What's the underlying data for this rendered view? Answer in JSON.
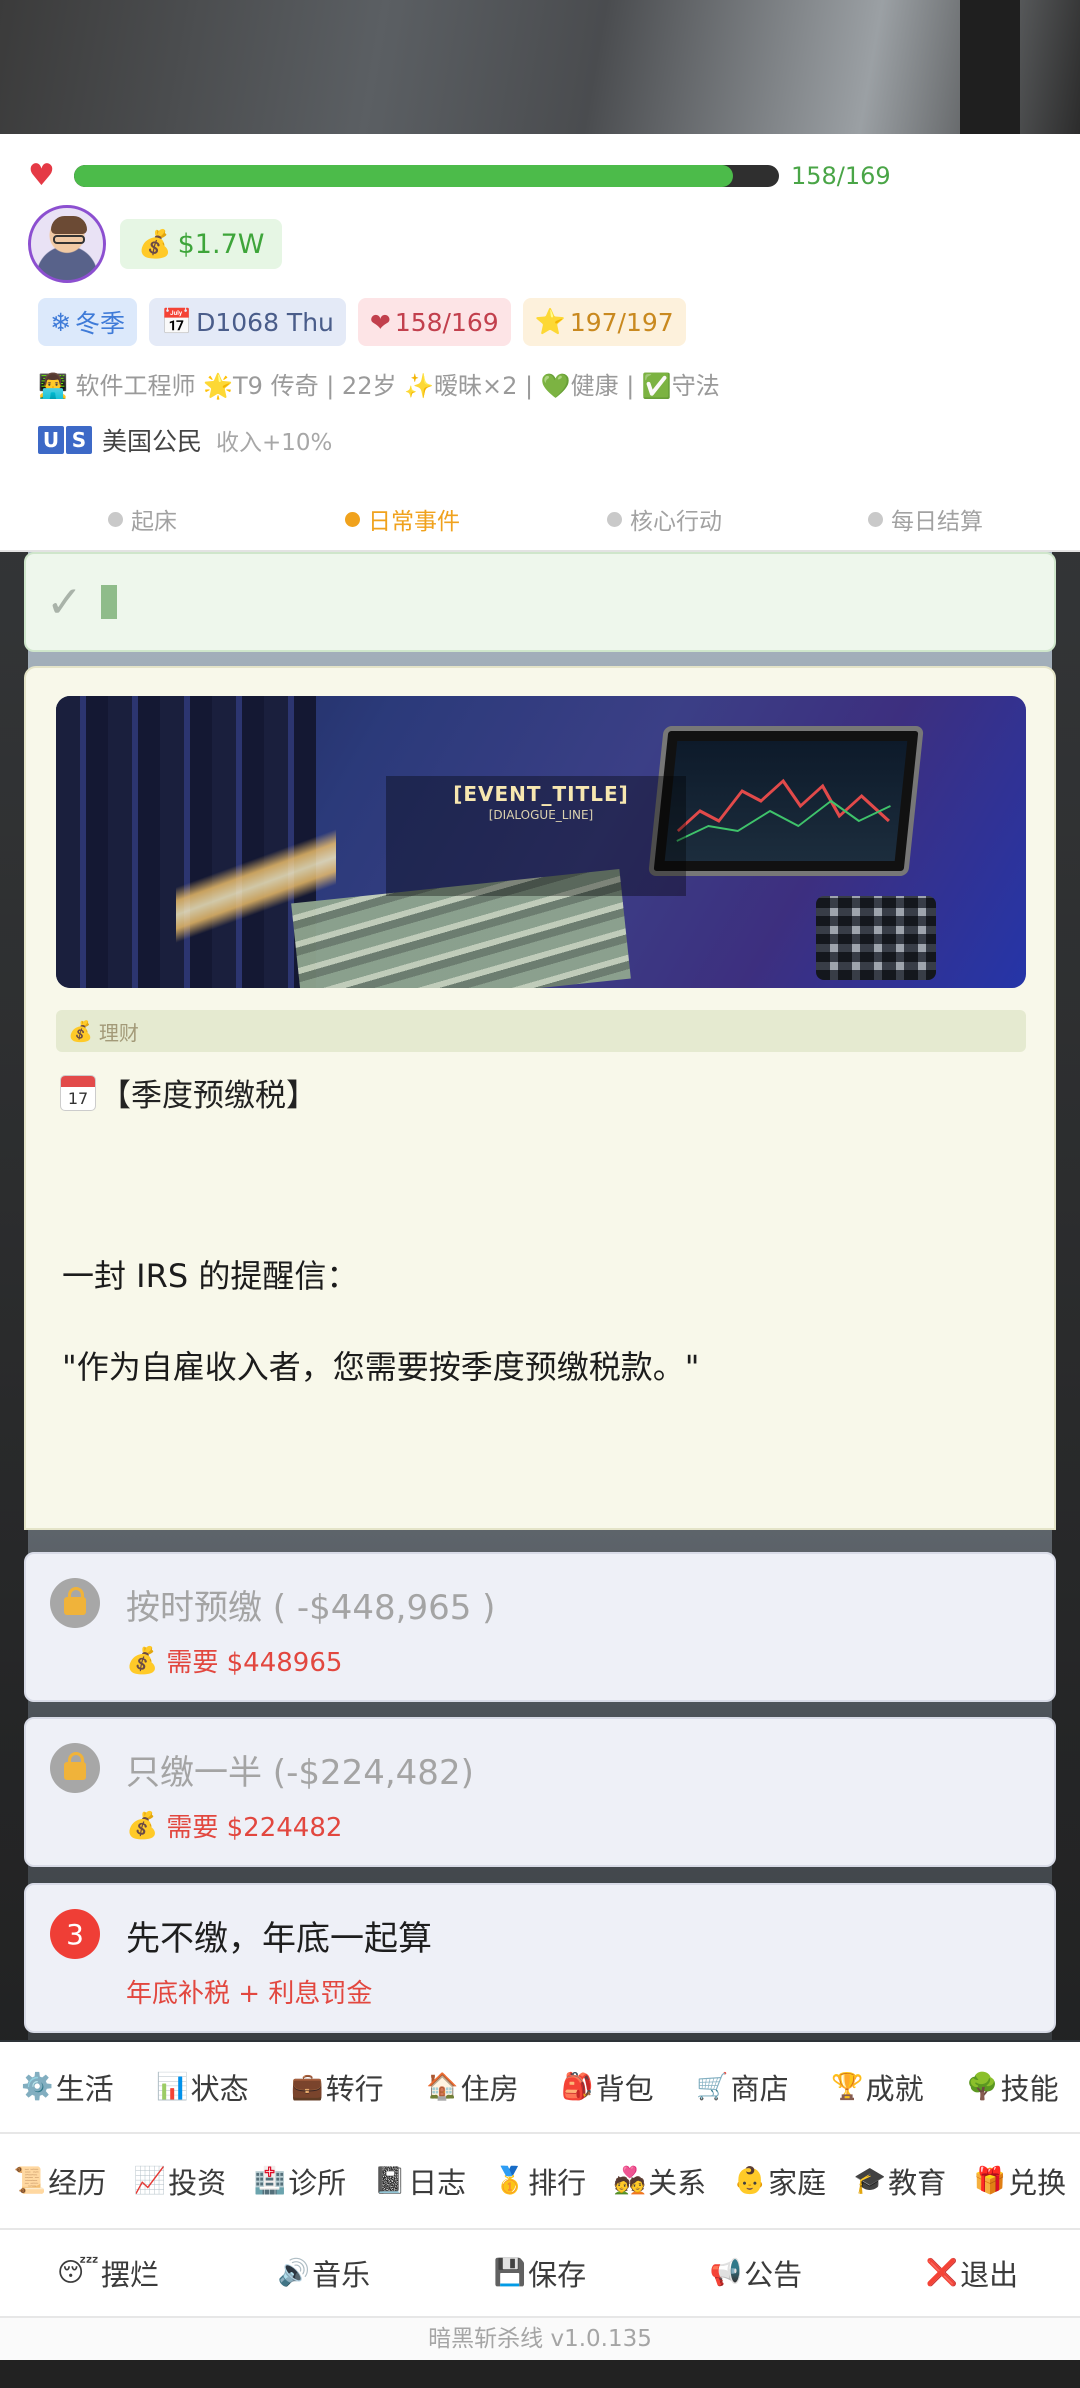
{
  "status": {
    "hp_current": 158,
    "hp_max": 169,
    "hp_text": "158/169",
    "money": "$1.7W"
  },
  "tags": {
    "season": "冬季",
    "day": "D1068 Thu",
    "hp": "158/169",
    "star": "197/197"
  },
  "profile": {
    "info_line": "👨‍💻 软件工程师 🌟T9 传奇 | 22岁 ✨暧昧×2 | 💚健康 | ✅守法",
    "flag_letters": [
      "U",
      "S"
    ],
    "citizen": "美国公民",
    "bonus": "收入+10%"
  },
  "phases": [
    {
      "label": "起床",
      "active": false
    },
    {
      "label": "日常事件",
      "active": true
    },
    {
      "label": "核心行动",
      "active": false
    },
    {
      "label": "每日结算",
      "active": false
    }
  ],
  "event": {
    "image_title": "[EVENT_TITLE]",
    "image_subtitle": "[DIALOGUE_LINE]",
    "category": "理财",
    "title": "【季度预缴税】",
    "calendar_day": "17",
    "body_line1": "一封 IRS 的提醒信：",
    "body_line2": "\"作为自雇收入者，您需要按季度预缴税款。\""
  },
  "choices": [
    {
      "label": "按时预缴 ( -$448,965 )",
      "sub": "需要 $448965",
      "locked": true
    },
    {
      "label": "只缴一半 (-$224,482)",
      "sub": "需要 $224482",
      "locked": true
    },
    {
      "number": "3",
      "label": "先不缴，年底一起算",
      "sub": "年底补税 + 利息罚金",
      "locked": false
    }
  ],
  "nav": {
    "row1": [
      {
        "icon": "⚙️",
        "label": "生活"
      },
      {
        "icon": "📊",
        "label": "状态"
      },
      {
        "icon": "💼",
        "label": "转行"
      },
      {
        "icon": "🏠",
        "label": "住房"
      },
      {
        "icon": "🎒",
        "label": "背包"
      },
      {
        "icon": "🛒",
        "label": "商店"
      },
      {
        "icon": "🏆",
        "label": "成就"
      },
      {
        "icon": "🌳",
        "label": "技能"
      }
    ],
    "row2": [
      {
        "icon": "📜",
        "label": "经历"
      },
      {
        "icon": "📈",
        "label": "投资"
      },
      {
        "icon": "🏥",
        "label": "诊所"
      },
      {
        "icon": "📓",
        "label": "日志"
      },
      {
        "icon": "🥇",
        "label": "排行"
      },
      {
        "icon": "💑",
        "label": "关系"
      },
      {
        "icon": "👶",
        "label": "家庭"
      },
      {
        "icon": "🎓",
        "label": "教育"
      },
      {
        "icon": "🎁",
        "label": "兑换"
      }
    ],
    "row3": [
      {
        "icon": "😴",
        "label": "摆烂"
      },
      {
        "icon": "🔊",
        "label": "音乐"
      },
      {
        "icon": "💾",
        "label": "保存"
      },
      {
        "icon": "📢",
        "label": "公告"
      },
      {
        "icon": "❌",
        "label": "退出"
      }
    ]
  },
  "version": "暗黑斩杀线 v1.0.135",
  "colors": {
    "hp_green": "#4cbb4a",
    "accent_orange": "#f0a21d",
    "danger_red": "#e2473f"
  }
}
